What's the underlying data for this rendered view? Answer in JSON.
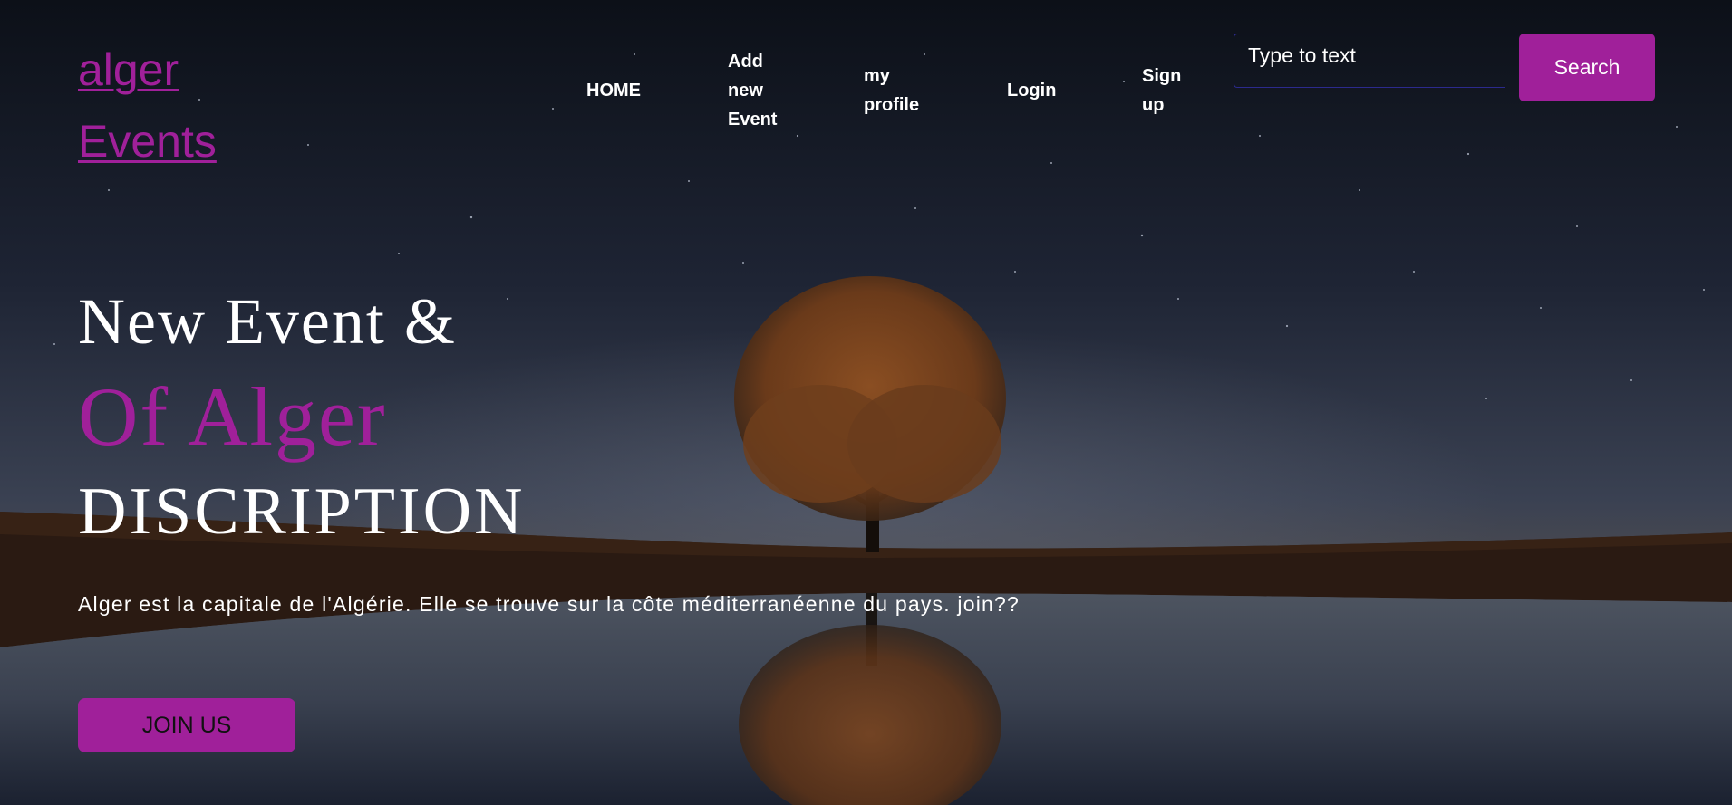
{
  "brand": {
    "logo_text": "alger Events"
  },
  "nav": {
    "items": [
      {
        "label": "HOME"
      },
      {
        "label": "Add new Event"
      },
      {
        "label": "my profile"
      },
      {
        "label": "Login"
      },
      {
        "label": "Sign up"
      }
    ]
  },
  "search": {
    "placeholder": "Type to text",
    "button_label": "Search"
  },
  "hero": {
    "line1": "New Event &",
    "line2": "Of Alger",
    "line3": "DISCRIPTION",
    "description": "Alger est la capitale de l'Algérie. Elle se trouve sur la côte méditerranéenne du pays. join??",
    "join_button": "JOIN US"
  },
  "colors": {
    "accent": "#a0209a",
    "text": "#ffffff",
    "sky_top": "#0c1018",
    "sky_mid": "#2c3446"
  },
  "icons": {
    "background": "night-tree-lake-image"
  }
}
